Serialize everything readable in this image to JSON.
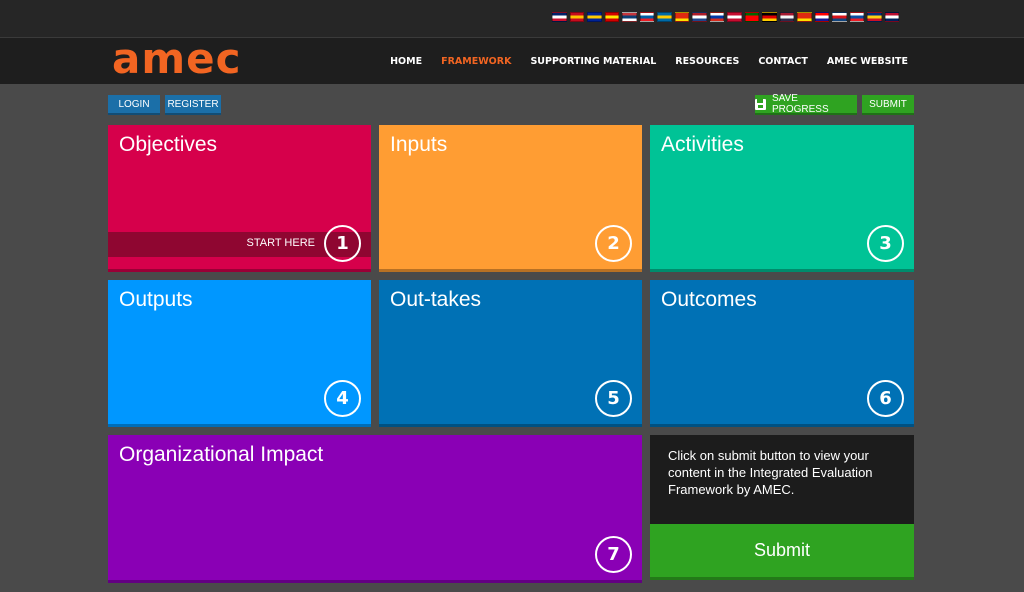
{
  "languages": [
    {
      "name": "uk-flag-icon",
      "colors": [
        "#012169",
        "#ffffff",
        "#c8102e"
      ]
    },
    {
      "name": "spain-flag-icon",
      "colors": [
        "#c60b1e",
        "#ffc400",
        "#c60b1e"
      ]
    },
    {
      "name": "bosnia-flag-icon",
      "colors": [
        "#002395",
        "#fecb00",
        "#002395"
      ]
    },
    {
      "name": "macedonia-flag-icon",
      "colors": [
        "#d20000",
        "#ffe600",
        "#d20000"
      ]
    },
    {
      "name": "serbia-flag-icon",
      "colors": [
        "#c6363c",
        "#0c4076",
        "#ffffff"
      ]
    },
    {
      "name": "slovenia-flag-icon",
      "colors": [
        "#ffffff",
        "#005da4",
        "#ed1c24"
      ]
    },
    {
      "name": "sweden-flag-icon",
      "colors": [
        "#006aa7",
        "#fecc00",
        "#006aa7"
      ]
    },
    {
      "name": "china-flag-icon",
      "colors": [
        "#de2910",
        "#de2910",
        "#ffde00"
      ]
    },
    {
      "name": "netherlands-flag-icon",
      "colors": [
        "#ae1c28",
        "#ffffff",
        "#21468b"
      ]
    },
    {
      "name": "russia-flag-icon",
      "colors": [
        "#ffffff",
        "#0039a6",
        "#d52b1e"
      ]
    },
    {
      "name": "denmark-flag-icon",
      "colors": [
        "#c60c30",
        "#ffffff",
        "#c60c30"
      ]
    },
    {
      "name": "portugal-flag-icon",
      "colors": [
        "#006600",
        "#ff0000",
        "#ff0000"
      ]
    },
    {
      "name": "germany-flag-icon",
      "colors": [
        "#000000",
        "#dd0000",
        "#ffce00"
      ]
    },
    {
      "name": "thailand-flag-icon",
      "colors": [
        "#a51931",
        "#f4f5f8",
        "#2d2a4a"
      ]
    },
    {
      "name": "china-flag-icon-2",
      "colors": [
        "#de2910",
        "#de2910",
        "#ffde00"
      ]
    },
    {
      "name": "croatia-flag-icon",
      "colors": [
        "#ff0000",
        "#ffffff",
        "#171796"
      ]
    },
    {
      "name": "czech-flag-icon",
      "colors": [
        "#ffffff",
        "#d7141a",
        "#11457e"
      ]
    },
    {
      "name": "slovakia-flag-icon",
      "colors": [
        "#ffffff",
        "#0b4ea2",
        "#ee1c25"
      ]
    },
    {
      "name": "romania-flag-icon",
      "colors": [
        "#002b7f",
        "#fcd116",
        "#ce1126"
      ]
    },
    {
      "name": "norway-flag-icon",
      "colors": [
        "#ba0c2f",
        "#ffffff",
        "#00205b"
      ]
    }
  ],
  "brand": {
    "logo": "amec",
    "color": "#f26522"
  },
  "nav": {
    "items": [
      {
        "label": "HOME",
        "active": false
      },
      {
        "label": "FRAMEWORK",
        "active": true
      },
      {
        "label": "SUPPORTING MATERIAL",
        "active": false
      },
      {
        "label": "RESOURCES",
        "active": false
      },
      {
        "label": "CONTACT",
        "active": false
      },
      {
        "label": "AMEC WEBSITE",
        "active": false
      }
    ]
  },
  "toolbar": {
    "login": "LOGIN",
    "register": "REGISTER",
    "save_progress": "SAVE PROGRESS",
    "submit": "SUBMIT"
  },
  "tiles": [
    {
      "title": "Objectives",
      "number": "1",
      "color": "#d6004b",
      "start_label": "START HERE"
    },
    {
      "title": "Inputs",
      "number": "2",
      "color": "#ff9d33"
    },
    {
      "title": "Activities",
      "number": "3",
      "color": "#00c396"
    },
    {
      "title": "Outputs",
      "number": "4",
      "color": "#0097ff"
    },
    {
      "title": "Out-takes",
      "number": "5",
      "color": "#0071b5"
    },
    {
      "title": "Outcomes",
      "number": "6",
      "color": "#0071b5"
    },
    {
      "title": "Organizational Impact",
      "number": "7",
      "color": "#8a00b5"
    }
  ],
  "info": {
    "text": "Click on submit button to view your content in the Integrated Evaluation Framework by AMEC.",
    "submit_label": "Submit"
  }
}
